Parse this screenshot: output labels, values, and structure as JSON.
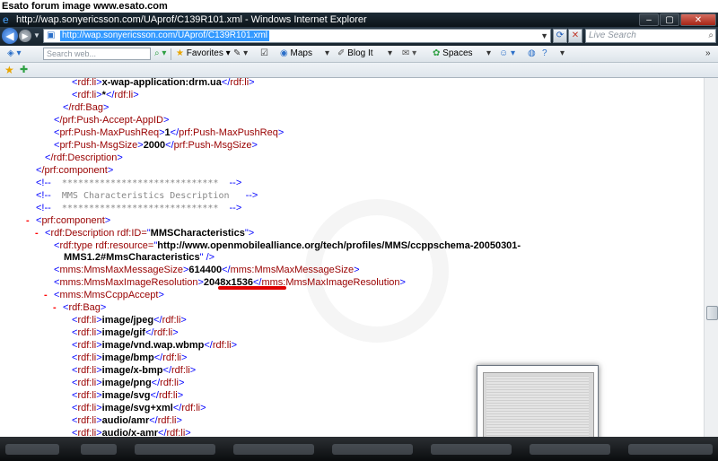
{
  "watermark": "Esato forum image www.esato.com",
  "window": {
    "title": "http://wap.sonyericsson.com/UAprof/C139R101.xml - Windows Internet Explorer",
    "minimize": "–",
    "maximize": "▢",
    "close": "✕"
  },
  "address_bar": {
    "url": "http://wap.sonyericsson.com/UAprof/C139R101.xml"
  },
  "live_search": {
    "placeholder": "Live Search"
  },
  "toolbar": {
    "search_placeholder": "Search web...",
    "favorites": "Favorites",
    "maps": "Maps",
    "blog_it": "Blog It",
    "spaces": "Spaces"
  },
  "xml": {
    "l1": {
      "open": "rdf:li",
      "text": "x-wap-application:drm.ua",
      "close": "rdf:li"
    },
    "l2": {
      "open": "rdf:li",
      "text": "*",
      "close": "rdf:li"
    },
    "l3": {
      "tag": "/rdf:Bag"
    },
    "l4": {
      "tag": "/prf:Push-Accept-AppID"
    },
    "l5": {
      "open": "prf:Push-MaxPushReq",
      "text": "1",
      "close": "prf:Push-MaxPushReq"
    },
    "l6": {
      "open": "prf:Push-MsgSize",
      "text": "2000",
      "close": "prf:Push-MsgSize"
    },
    "l7": {
      "tag": "/rdf:Description"
    },
    "l8": {
      "tag": "/prf:component"
    },
    "c1": "*****************************",
    "c2": "MMS Characteristics Description",
    "c3": "*****************************",
    "l9": {
      "tag": "prf:component"
    },
    "l10": {
      "tag": "rdf:Description",
      "attr": "rdf:ID=",
      "value": "MMSCharacteristics"
    },
    "l11": {
      "tag": "rdf:type",
      "attr": "rdf:resource=",
      "value": "http://www.openmobilealliance.org/tech/profiles/MMS/ccppschema-20050301-"
    },
    "l11b": {
      "value": "MMS1.2#MmsCharacteristics"
    },
    "l12": {
      "open": "mms:MmsMaxMessageSize",
      "text": "614400",
      "close": "mms:MmsMaxMessageSize"
    },
    "l13": {
      "open": "mms:MmsMaxImageResolution",
      "text": "2048x1536",
      "close": "mms:MmsMaxImageResolution"
    },
    "l14": {
      "tag": "mms:MmsCcppAccept"
    },
    "l15": {
      "tag": "rdf:Bag"
    },
    "items": [
      "image/jpeg",
      "image/gif",
      "image/vnd.wap.wbmp",
      "image/bmp",
      "image/x-bmp",
      "image/png",
      "image/svg",
      "image/svg+xml",
      "audio/amr",
      "audio/x-amr"
    ]
  }
}
